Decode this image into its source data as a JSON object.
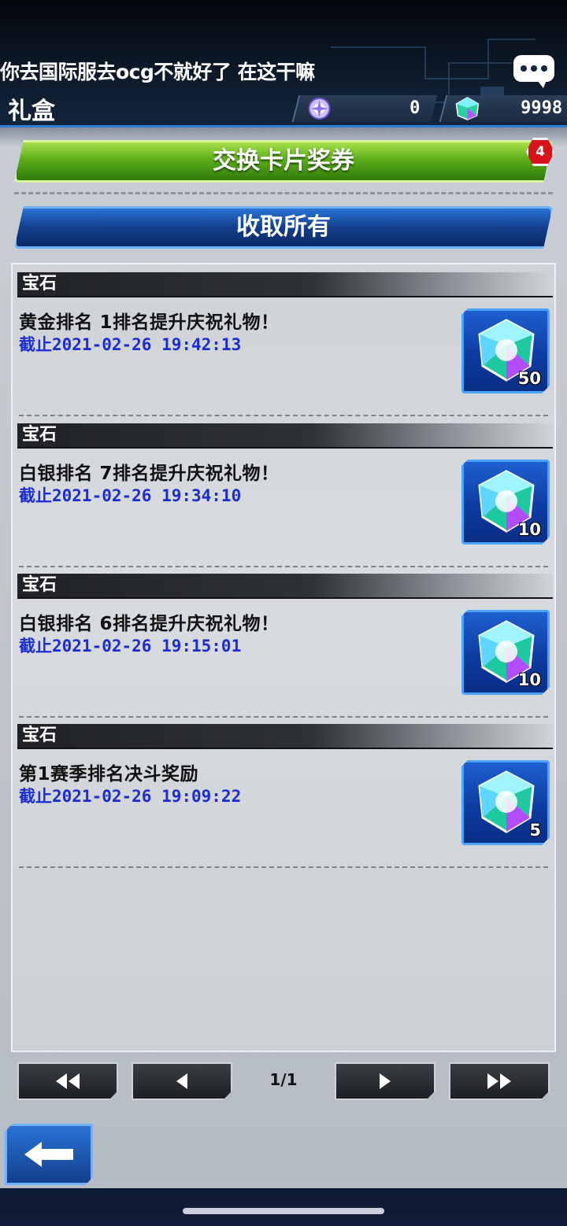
{
  "header": {
    "chat_message": "你去国际服去ocg不就好了 在这干嘛",
    "page_title": "礼盒",
    "currency_orb": "0",
    "currency_gem": "9998"
  },
  "actions": {
    "exchange_label": "交换卡片奖券",
    "exchange_badge": "4",
    "claim_all_label": "收取所有"
  },
  "items": [
    {
      "category": "宝石",
      "title": "黄金排名 1排名提升庆祝礼物！",
      "deadline": "截止2021-02-26 19:42:13",
      "count": "50"
    },
    {
      "category": "宝石",
      "title": "白银排名 7排名提升庆祝礼物！",
      "deadline": "截止2021-02-26 19:34:10",
      "count": "10"
    },
    {
      "category": "宝石",
      "title": "白银排名 6排名提升庆祝礼物！",
      "deadline": "截止2021-02-26 19:15:01",
      "count": "10"
    },
    {
      "category": "宝石",
      "title": "第1赛季排名决斗奖励",
      "deadline": "截止2021-02-26 19:09:22",
      "count": "5"
    }
  ],
  "pagination": {
    "label": "1/1"
  },
  "icons": {
    "chat": "chat-bubble-icon",
    "orb": "orb-currency-icon",
    "gem": "gem-icon",
    "first": "first-page-icon",
    "prev": "prev-page-icon",
    "next": "next-page-icon",
    "last": "last-page-icon",
    "back": "back-arrow-icon"
  },
  "colors": {
    "exchange_button": "#5cae1a",
    "claim_button": "#123f8c",
    "deadline_text": "#1b2cd4",
    "badge": "#d7121a"
  }
}
